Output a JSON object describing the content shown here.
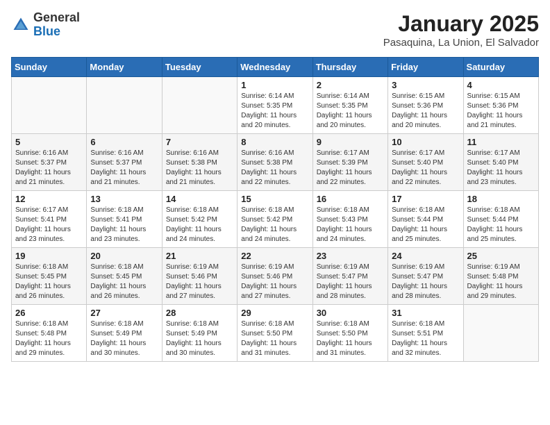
{
  "header": {
    "logo_general": "General",
    "logo_blue": "Blue",
    "month_title": "January 2025",
    "location": "Pasaquina, La Union, El Salvador"
  },
  "weekdays": [
    "Sunday",
    "Monday",
    "Tuesday",
    "Wednesday",
    "Thursday",
    "Friday",
    "Saturday"
  ],
  "weeks": [
    [
      {
        "day": "",
        "info": ""
      },
      {
        "day": "",
        "info": ""
      },
      {
        "day": "",
        "info": ""
      },
      {
        "day": "1",
        "info": "Sunrise: 6:14 AM\nSunset: 5:35 PM\nDaylight: 11 hours and 20 minutes."
      },
      {
        "day": "2",
        "info": "Sunrise: 6:14 AM\nSunset: 5:35 PM\nDaylight: 11 hours and 20 minutes."
      },
      {
        "day": "3",
        "info": "Sunrise: 6:15 AM\nSunset: 5:36 PM\nDaylight: 11 hours and 20 minutes."
      },
      {
        "day": "4",
        "info": "Sunrise: 6:15 AM\nSunset: 5:36 PM\nDaylight: 11 hours and 21 minutes."
      }
    ],
    [
      {
        "day": "5",
        "info": "Sunrise: 6:16 AM\nSunset: 5:37 PM\nDaylight: 11 hours and 21 minutes."
      },
      {
        "day": "6",
        "info": "Sunrise: 6:16 AM\nSunset: 5:37 PM\nDaylight: 11 hours and 21 minutes."
      },
      {
        "day": "7",
        "info": "Sunrise: 6:16 AM\nSunset: 5:38 PM\nDaylight: 11 hours and 21 minutes."
      },
      {
        "day": "8",
        "info": "Sunrise: 6:16 AM\nSunset: 5:38 PM\nDaylight: 11 hours and 22 minutes."
      },
      {
        "day": "9",
        "info": "Sunrise: 6:17 AM\nSunset: 5:39 PM\nDaylight: 11 hours and 22 minutes."
      },
      {
        "day": "10",
        "info": "Sunrise: 6:17 AM\nSunset: 5:40 PM\nDaylight: 11 hours and 22 minutes."
      },
      {
        "day": "11",
        "info": "Sunrise: 6:17 AM\nSunset: 5:40 PM\nDaylight: 11 hours and 23 minutes."
      }
    ],
    [
      {
        "day": "12",
        "info": "Sunrise: 6:17 AM\nSunset: 5:41 PM\nDaylight: 11 hours and 23 minutes."
      },
      {
        "day": "13",
        "info": "Sunrise: 6:18 AM\nSunset: 5:41 PM\nDaylight: 11 hours and 23 minutes."
      },
      {
        "day": "14",
        "info": "Sunrise: 6:18 AM\nSunset: 5:42 PM\nDaylight: 11 hours and 24 minutes."
      },
      {
        "day": "15",
        "info": "Sunrise: 6:18 AM\nSunset: 5:42 PM\nDaylight: 11 hours and 24 minutes."
      },
      {
        "day": "16",
        "info": "Sunrise: 6:18 AM\nSunset: 5:43 PM\nDaylight: 11 hours and 24 minutes."
      },
      {
        "day": "17",
        "info": "Sunrise: 6:18 AM\nSunset: 5:44 PM\nDaylight: 11 hours and 25 minutes."
      },
      {
        "day": "18",
        "info": "Sunrise: 6:18 AM\nSunset: 5:44 PM\nDaylight: 11 hours and 25 minutes."
      }
    ],
    [
      {
        "day": "19",
        "info": "Sunrise: 6:18 AM\nSunset: 5:45 PM\nDaylight: 11 hours and 26 minutes."
      },
      {
        "day": "20",
        "info": "Sunrise: 6:18 AM\nSunset: 5:45 PM\nDaylight: 11 hours and 26 minutes."
      },
      {
        "day": "21",
        "info": "Sunrise: 6:19 AM\nSunset: 5:46 PM\nDaylight: 11 hours and 27 minutes."
      },
      {
        "day": "22",
        "info": "Sunrise: 6:19 AM\nSunset: 5:46 PM\nDaylight: 11 hours and 27 minutes."
      },
      {
        "day": "23",
        "info": "Sunrise: 6:19 AM\nSunset: 5:47 PM\nDaylight: 11 hours and 28 minutes."
      },
      {
        "day": "24",
        "info": "Sunrise: 6:19 AM\nSunset: 5:47 PM\nDaylight: 11 hours and 28 minutes."
      },
      {
        "day": "25",
        "info": "Sunrise: 6:19 AM\nSunset: 5:48 PM\nDaylight: 11 hours and 29 minutes."
      }
    ],
    [
      {
        "day": "26",
        "info": "Sunrise: 6:18 AM\nSunset: 5:48 PM\nDaylight: 11 hours and 29 minutes."
      },
      {
        "day": "27",
        "info": "Sunrise: 6:18 AM\nSunset: 5:49 PM\nDaylight: 11 hours and 30 minutes."
      },
      {
        "day": "28",
        "info": "Sunrise: 6:18 AM\nSunset: 5:49 PM\nDaylight: 11 hours and 30 minutes."
      },
      {
        "day": "29",
        "info": "Sunrise: 6:18 AM\nSunset: 5:50 PM\nDaylight: 11 hours and 31 minutes."
      },
      {
        "day": "30",
        "info": "Sunrise: 6:18 AM\nSunset: 5:50 PM\nDaylight: 11 hours and 31 minutes."
      },
      {
        "day": "31",
        "info": "Sunrise: 6:18 AM\nSunset: 5:51 PM\nDaylight: 11 hours and 32 minutes."
      },
      {
        "day": "",
        "info": ""
      }
    ]
  ]
}
